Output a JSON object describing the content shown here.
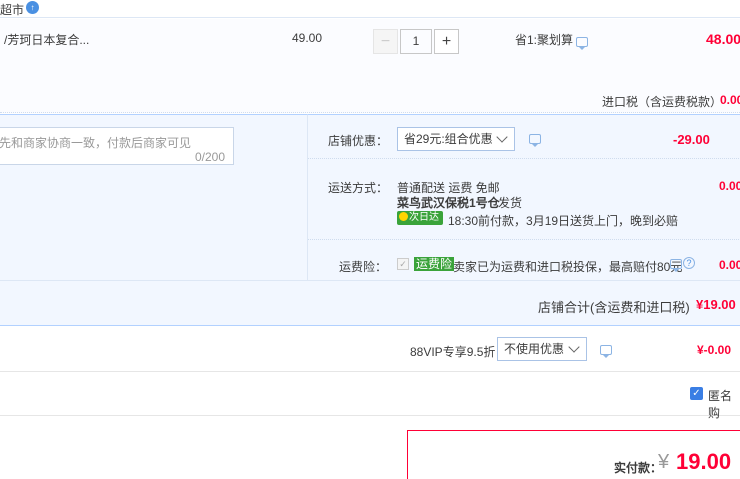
{
  "shop": {
    "name_fragment": "超市",
    "badge": "↑"
  },
  "item": {
    "title": "/芳珂日本复合...",
    "unit_price": "49.00",
    "quantity": "1",
    "promo": "省1:聚划算",
    "subtotal": "48.00"
  },
  "tax": {
    "label": "进口税（含运费税款）",
    "value": "0.00"
  },
  "message": {
    "placeholder": "先和商家协商一致，付款后商家可见",
    "count": "0/200"
  },
  "discount": {
    "label": "店铺优惠：",
    "selected": "省29元:组合优惠",
    "value": "-29.00"
  },
  "shipping": {
    "label": "运送方式：",
    "method": "普通配送 运费 免邮",
    "warehouse": "菜鸟武汉保税1号仓",
    "dispatch": "发货",
    "badge": "次日达",
    "eta": "18:30前付款，3月19日送货上门，晚到必赔",
    "value": "0.00"
  },
  "insurance": {
    "label": "运费险：",
    "tag": "运费险",
    "text": "卖家已为运费和进口税投保，最高赔付80元",
    "value": "0.00"
  },
  "store_total": {
    "label": "店铺合计(含运费和进口税)",
    "value": "¥19.00"
  },
  "vip": {
    "label": "88VIP专享9.5折",
    "selected": "不使用优惠",
    "value": "¥-0.00"
  },
  "anonymous": {
    "label": "匿名购"
  },
  "payment": {
    "label": "实付款：",
    "currency": "¥",
    "amount": "19.00"
  },
  "colors": {
    "accent": "#ff0036",
    "panel": "#f2f7ff",
    "border": "#b2d1ff"
  }
}
